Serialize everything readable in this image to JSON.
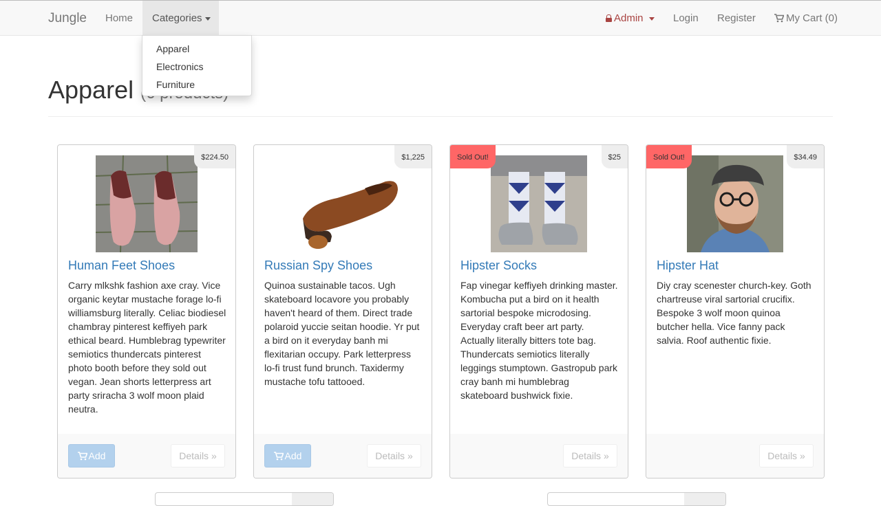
{
  "navbar": {
    "brand": "Jungle",
    "home": "Home",
    "categories": "Categories",
    "admin": "Admin",
    "login": "Login",
    "register": "Register",
    "cart": "My Cart (0)"
  },
  "dropdown": {
    "items": [
      "Apparel",
      "Electronics",
      "Furniture"
    ]
  },
  "page": {
    "title": "Apparel",
    "count": "(6 products)"
  },
  "products": [
    {
      "name": "Human Feet Shoes",
      "price": "$224.50",
      "sold_out": "",
      "description": "Carry mlkshk fashion axe cray. Vice organic keytar mustache forage lo-fi williamsburg literally. Celiac biodiesel chambray pinterest keffiyeh park ethical beard. Humblebrag typewriter semiotics thundercats pinterest photo booth before they sold out vegan. Jean shorts letterpress art party sriracha 3 wolf moon plaid neutra.",
      "add_label": "Add",
      "details_label": "Details »"
    },
    {
      "name": "Russian Spy Shoes",
      "price": "$1,225",
      "sold_out": "",
      "description": "Quinoa sustainable tacos. Ugh skateboard locavore you probably haven't heard of them. Direct trade polaroid yuccie seitan hoodie. Yr put a bird on it everyday banh mi flexitarian occupy. Park letterpress lo-fi trust fund brunch. Taxidermy mustache tofu tattooed.",
      "add_label": "Add",
      "details_label": "Details »"
    },
    {
      "name": "Hipster Socks",
      "price": "$25",
      "sold_out": "Sold Out!",
      "description": "Fap vinegar keffiyeh drinking master. Kombucha put a bird on it health sartorial bespoke microdosing. Everyday craft beer art party. Actually literally bitters tote bag. Thundercats semiotics literally leggings stumptown. Gastropub park cray banh mi humblebrag skateboard bushwick fixie.",
      "add_label": "",
      "details_label": "Details »"
    },
    {
      "name": "Hipster Hat",
      "price": "$34.49",
      "sold_out": "Sold Out!",
      "description": "Diy cray scenester church-key. Goth chartreuse viral sartorial crucifix. Bespoke 3 wolf moon quinoa butcher hella. Vice fanny pack salvia. Roof authentic fixie.",
      "add_label": "",
      "details_label": "Details »"
    }
  ],
  "colors": {
    "link": "#337ab7",
    "sold_out": "#ff6666",
    "admin": "#a94442"
  },
  "icons": {
    "lock": "lock-icon",
    "cart": "cart-icon",
    "caret": "caret-down-icon"
  }
}
